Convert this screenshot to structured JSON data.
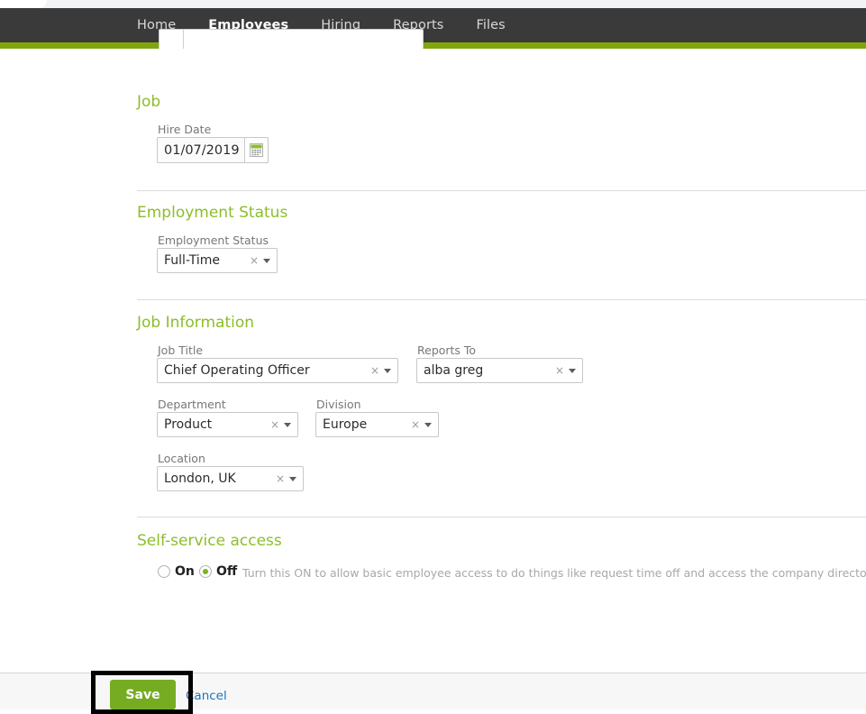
{
  "nav": {
    "items": [
      {
        "label": "Home",
        "active": false
      },
      {
        "label": "Employees",
        "active": true
      },
      {
        "label": "Hiring",
        "active": false
      },
      {
        "label": "Reports",
        "active": false
      },
      {
        "label": "Files",
        "active": false
      }
    ]
  },
  "colors": {
    "nav_bg": "#3a3a3a",
    "nav_accent_bar": "#7fa70c",
    "heading_green": "#8cbe2a",
    "save_green": "#76ac22",
    "link_blue": "#1a74c0",
    "radio_selected": "#79b51d",
    "highlight_box": "#000000"
  },
  "sections": {
    "job": {
      "title": "Job",
      "hire_date": {
        "label": "Hire Date",
        "value": "01/07/2019",
        "calendar_icon": "calendar-icon"
      }
    },
    "employment_status": {
      "title": "Employment Status",
      "field": {
        "label": "Employment Status",
        "value": "Full-Time"
      }
    },
    "job_information": {
      "title": "Job Information",
      "job_title": {
        "label": "Job Title",
        "value": "Chief Operating Officer"
      },
      "reports_to": {
        "label": "Reports To",
        "value": "alba greg"
      },
      "department": {
        "label": "Department",
        "value": "Product"
      },
      "division": {
        "label": "Division",
        "value": "Europe"
      },
      "location": {
        "label": "Location",
        "value": "London, UK"
      }
    },
    "self_service": {
      "title": "Self-service access",
      "option_on": "On",
      "option_off": "Off",
      "selected": "Off",
      "help_text": "Turn this ON to allow basic employee access to do things like request time off and access the company directory."
    }
  },
  "footer": {
    "save_label": "Save",
    "cancel_label": "Cancel"
  },
  "icons": {
    "clear": "×"
  }
}
